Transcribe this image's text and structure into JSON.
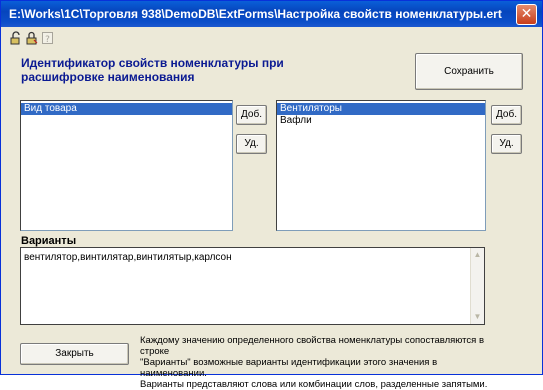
{
  "window": {
    "title": "E:\\Works\\1C\\Торговля 938\\DemoDB\\ExtForms\\Настройка свойств номенклатуры.ert",
    "close_glyph": "✕"
  },
  "toolbar": {
    "icons": [
      "lock-open-icon",
      "lock-closed-icon",
      "help-icon"
    ]
  },
  "heading": {
    "line1": "Идентификатор свойств номенклатуры при",
    "line2": "расшифровке наименования"
  },
  "save_button": "Сохранить",
  "left_list": {
    "items": [
      {
        "label": "Вид товара",
        "selected": true
      }
    ],
    "add_label": "Доб.",
    "remove_label": "Уд."
  },
  "right_list": {
    "items": [
      {
        "label": "Вентиляторы",
        "selected": true
      },
      {
        "label": "Вафли",
        "selected": false
      }
    ],
    "add_label": "Доб.",
    "remove_label": "Уд."
  },
  "variants": {
    "label": "Варианты",
    "value": "вентилятор,винтилятар,винтилятыр,карлсон"
  },
  "close_button": "Закрыть",
  "hint": {
    "line1": "Каждому значению определенного свойства номенклатуры сопоставляются в строке",
    "line2": "\"Варианты\" возможные варианты идентификации этого значения в наименовании.",
    "line3": "Варианты представляют слова или комбинации слов, разделенные запятыми."
  },
  "colors": {
    "titlebar": "#0645bd",
    "heading": "#0b1a92",
    "selection": "#316ac5",
    "dialog_bg": "#ece9d8"
  }
}
